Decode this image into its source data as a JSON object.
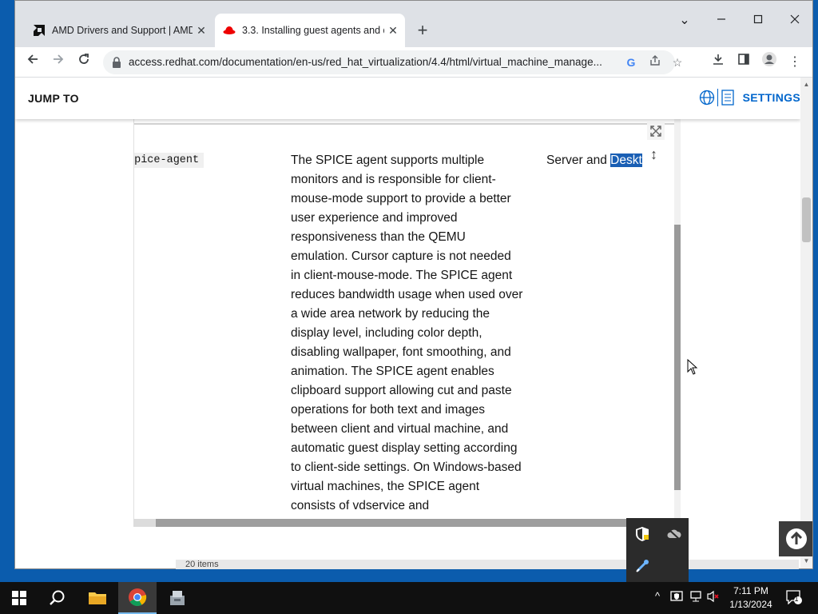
{
  "browser": {
    "tabs": [
      {
        "title": "AMD Drivers and Support | AMD",
        "favicon": "amd-logo-icon",
        "active": false
      },
      {
        "title": "3.3. Installing guest agents and d",
        "favicon": "redhat-logo-icon",
        "active": true
      }
    ],
    "url": "access.redhat.com/documentation/en-us/red_hat_virtualization/4.4/html/virtual_machine_manage..."
  },
  "page": {
    "jump_to": "JUMP TO",
    "settings": "SETTINGS",
    "row": {
      "code": "spice-agent",
      "description": "The SPICE agent supports multiple monitors and is responsible for client-mouse-mode support to provide a better user experience and improved responsiveness than the QEMU emulation. Cursor capture is not needed in client-mouse-mode. The SPICE agent reduces bandwidth usage when used over a wide area network by reducing the display level, including color depth, disabling wallpaper, font smoothing, and animation. The SPICE agent enables clipboard support allowing cut and paste operations for both text and images between client and virtual machine, and automatic guest display setting according to client-side settings. On Windows-based virtual machines, the SPICE agent consists of vdservice and",
      "os_prefix": "Server and ",
      "os_selected": "Deskt"
    },
    "underlay_text": "20 items"
  },
  "taskbar": {
    "time": "7:11 PM",
    "date": "1/13/2024",
    "notification_count": "1"
  },
  "colors": {
    "accent_blue": "#0066cc",
    "selection": "#1a5fb4"
  }
}
